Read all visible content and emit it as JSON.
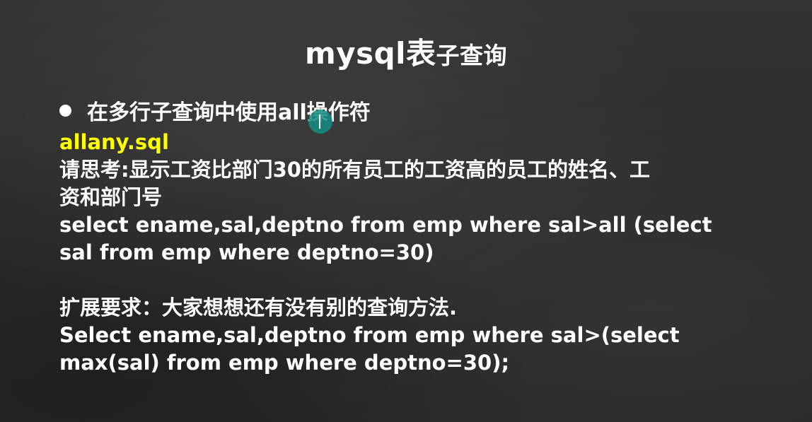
{
  "slide": {
    "title_main": "mysql表",
    "title_sub": "子查询",
    "bullet": "在多行子查询中使用all操作符",
    "file_name": "allany.sql",
    "question_line1": "请思考:显示工资比部门30的所有员工的工资高的员工的姓名、工",
    "question_line2": "资和部门号",
    "sql1_line1": "select ename,sal,deptno from emp where sal>all (select",
    "sql1_line2": "sal from emp where deptno=30)",
    "extension": "扩展要求：大家想想还有没有别的查询方法.",
    "sql2_line1": "Select ename,sal,deptno from emp  where sal>(select",
    "sql2_line2": "max(sal) from emp where deptno=30);"
  },
  "colors": {
    "background": "#2e2e2e",
    "text": "#ffffff",
    "highlight": "#ffff00",
    "cursor_circle": "#148c82"
  },
  "icons": {
    "bullet": "filled-circle-bullet",
    "cursor": "text-cursor-icon"
  }
}
